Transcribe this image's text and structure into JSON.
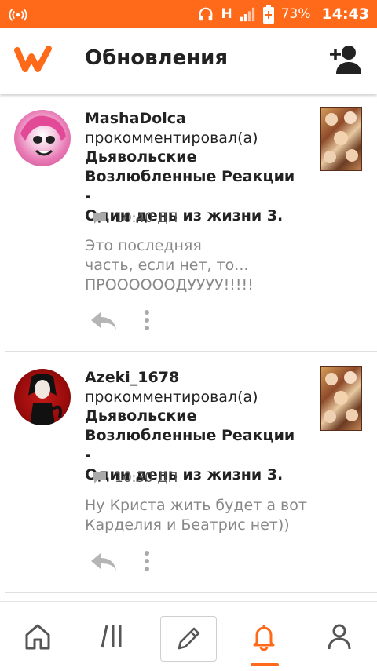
{
  "status_bar": {
    "network": "H",
    "battery": "73%",
    "time": "14:43"
  },
  "header": {
    "title": "Обновления"
  },
  "feed": [
    {
      "user": "MashaDolca",
      "action": "прокомментировал(а)",
      "story_lines": [
        "Дьявольские",
        "Возлюбленные Реакции -",
        "Один день из жизни 3."
      ],
      "time": "10:40 ДП",
      "comment_lines": [
        "Это последняя",
        "часть, если нет, то...",
        "ПРООООООДУУУУ!!!!!"
      ]
    },
    {
      "user": "Azeki_1678",
      "action": "прокомментировал(а)",
      "story_lines": [
        "Дьявольские",
        "Возлюбленные Реакции -",
        "Один день из жизни 3."
      ],
      "time": "10:30 ДП",
      "comment_lines": [
        "Ну Криста жить будет а вот",
        "Карделия и Беатрис нет))"
      ]
    }
  ],
  "colors": {
    "accent": "#ff6a1a"
  },
  "icons": {
    "add_user": "add-user-icon",
    "home": "home-icon",
    "library": "library-icon",
    "write": "pencil-icon",
    "notifications": "bell-icon",
    "profile": "profile-icon"
  }
}
